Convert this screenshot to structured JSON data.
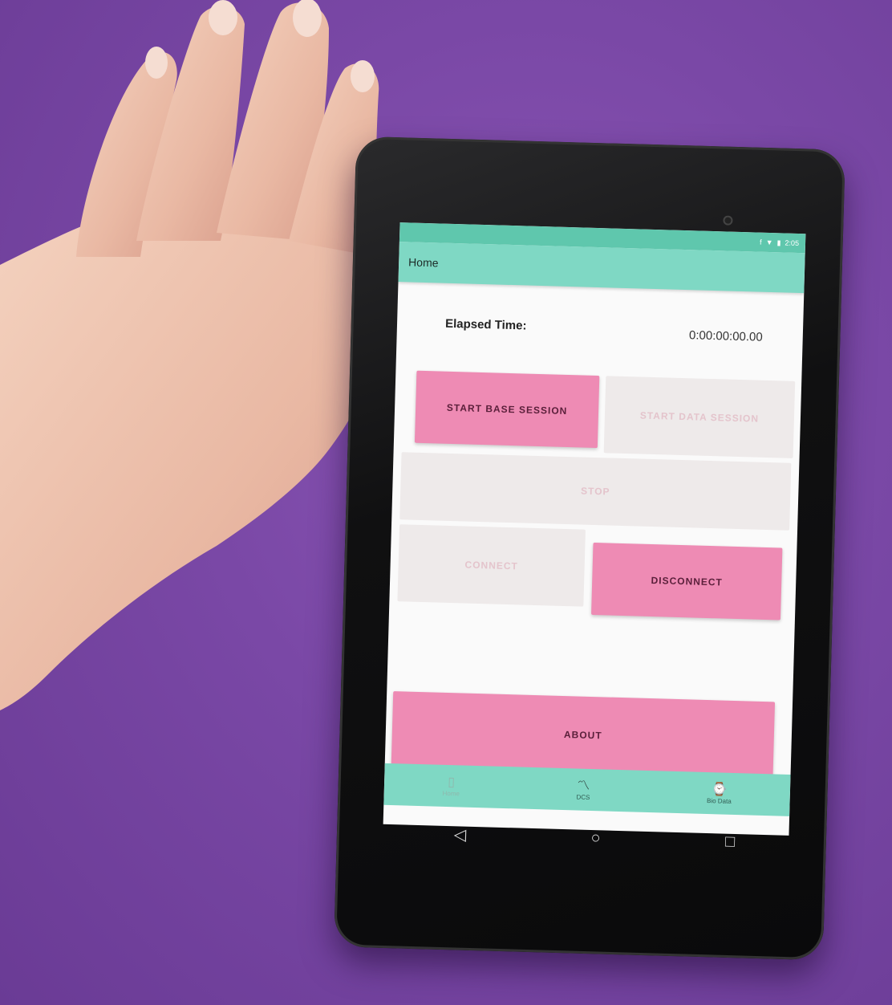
{
  "status_bar": {
    "time": "2:05"
  },
  "app_bar": {
    "title": "Home"
  },
  "elapsed": {
    "label": "Elapsed Time:",
    "value": "0:00:00:00.00"
  },
  "buttons": {
    "start_base": "START BASE SESSION",
    "start_data": "START DATA SESSION",
    "stop": "STOP",
    "connect": "CONNECT",
    "disconnect": "DISCONNECT",
    "about": "ABOUT"
  },
  "bottom_nav": [
    {
      "label": "Home",
      "icon": "phone-icon"
    },
    {
      "label": "DCS",
      "icon": "chart-line-icon"
    },
    {
      "label": "Bio Data",
      "icon": "watch-icon"
    }
  ],
  "colors": {
    "background": "#7a48a6",
    "accent": "#7fd8c4",
    "button_active": "#ee8bb4",
    "button_disabled": "#eeeaea"
  }
}
